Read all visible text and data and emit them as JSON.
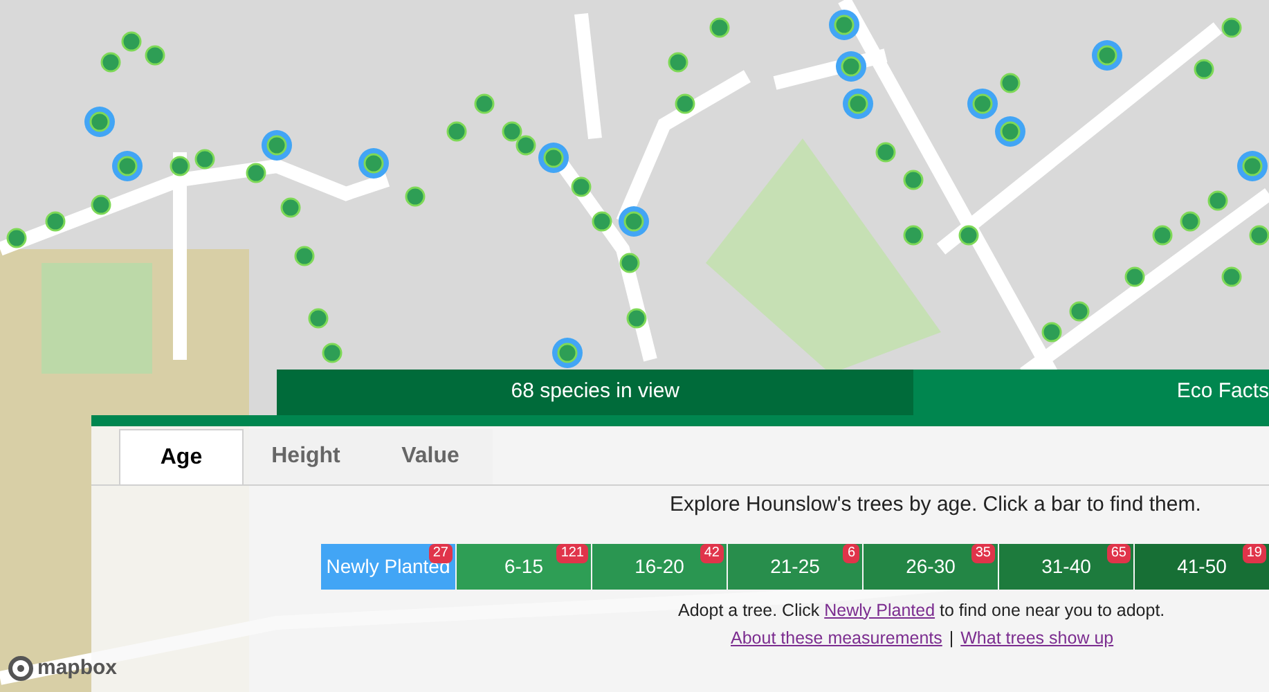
{
  "view_tabs": [
    {
      "label": "68 species in view",
      "selected": true
    },
    {
      "label": "Eco Facts",
      "selected": false
    }
  ],
  "measure_tabs": [
    {
      "label": "Age",
      "selected": true
    },
    {
      "label": "Height",
      "selected": false
    },
    {
      "label": "Value",
      "selected": false
    }
  ],
  "intro": "Explore Hounslow's trees by age. Click a bar to find them.",
  "bars": [
    {
      "label": "Newly Planted",
      "count": "27",
      "color": "#42a5f5"
    },
    {
      "label": "6-15",
      "count": "121",
      "color": "#2e9e55"
    },
    {
      "label": "16-20",
      "count": "42",
      "color": "#2a9651"
    },
    {
      "label": "21-25",
      "count": "6",
      "color": "#288e4c"
    },
    {
      "label": "26-30",
      "count": "35",
      "color": "#238645"
    },
    {
      "label": "31-40",
      "count": "65",
      "color": "#1d7b3d"
    },
    {
      "label": "41-50",
      "count": "19",
      "color": "#176f35"
    }
  ],
  "adopt": {
    "before": "Adopt a tree. Click",
    "link": "Newly Planted",
    "after": "to find one near you to adopt."
  },
  "links": [
    {
      "label": "About these measurements"
    },
    {
      "label": "What trees show up"
    }
  ],
  "separator": "|",
  "attribution": "mapbox"
}
